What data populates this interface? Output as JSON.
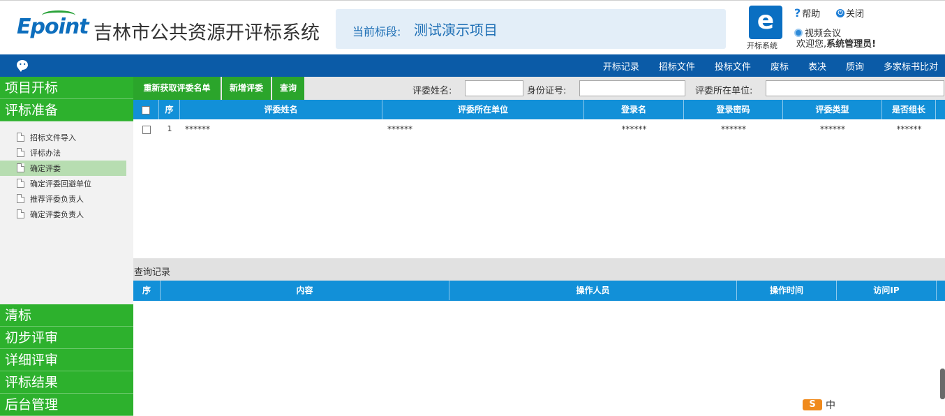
{
  "header": {
    "logo_text": "Epoint",
    "system_title": "吉林市公共资源开评标系统",
    "stage_label": "当前标段:",
    "stage_value": "测试演示项目",
    "sys_icon_glyph": "e",
    "sys_icon_label": "开标系统",
    "help": "帮助",
    "close": "关闭",
    "video": "视频会议",
    "welcome_prefix": "欢迎您,",
    "welcome_user": "系统管理员!"
  },
  "nav": {
    "items": [
      "开标记录",
      "招标文件",
      "投标文件",
      "废标",
      "表决",
      "质询",
      "多家标书比对"
    ]
  },
  "sidebar": {
    "top_sections": [
      "项目开标",
      "评标准备"
    ],
    "tree_items": [
      "招标文件导入",
      "评标办法",
      "确定评委",
      "确定评委回避单位",
      "推荐评委负责人",
      "确定评委负责人"
    ],
    "active_item": "确定评委",
    "bottom_sections": [
      "清标",
      "初步评审",
      "详细评审",
      "评标结果",
      "后台管理"
    ]
  },
  "toolbar": {
    "refetch_label": "重新获取评委名单",
    "add_label": "新增评委",
    "query_label": "查询",
    "name_label": "评委姓名:",
    "id_label": "身份证号:",
    "unit_label": "评委所在单位:"
  },
  "grid": {
    "columns": [
      "序",
      "评委姓名",
      "评委所在单位",
      "登录名",
      "登录密码",
      "评委类型",
      "是否组长"
    ],
    "rows": [
      {
        "index": "1",
        "name": "******",
        "unit": "******",
        "login": "******",
        "password": "******",
        "type": "******",
        "leader": "******"
      }
    ]
  },
  "log": {
    "title": "查询记录",
    "columns": [
      "序",
      "内容",
      "操作人员",
      "操作时间",
      "访问IP"
    ]
  },
  "tray": {
    "ime_label": "S",
    "ime_mode": "中"
  },
  "colors": {
    "brand_blue": "#0b5ba7",
    "grid_header": "#1290d8",
    "sidebar_green": "#2db12d",
    "active_item": "#b7ddb1"
  }
}
